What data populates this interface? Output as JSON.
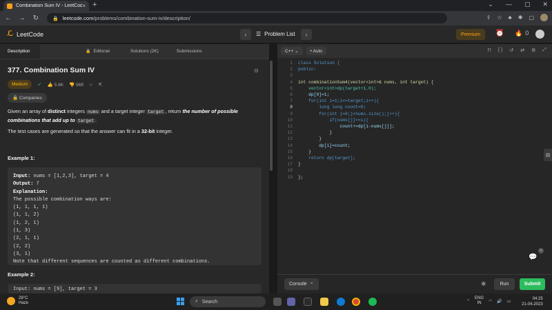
{
  "browser": {
    "tab_title": "Combination Sum IV - LeetCode",
    "tab_close": "×",
    "new_tab": "+",
    "window_controls": [
      "⌄",
      "—",
      "▢",
      "✕"
    ],
    "url_host": "leetcode.com",
    "url_path": "/problems/combination-sum-iv/description/",
    "extensions": [
      "⇪",
      "☆",
      "♣",
      "✱",
      "▢"
    ]
  },
  "header": {
    "logo": "LeetCode",
    "problem_list": "Problem List",
    "premium": "Premium",
    "streak": "0"
  },
  "left_tabs": [
    "Description",
    "Editorial",
    "Solutions (2K)",
    "Submissions"
  ],
  "problem": {
    "title": "377. Combination Sum IV",
    "difficulty": "Medium",
    "likes": "5.6K",
    "dislikes": "569",
    "companies": "Companies",
    "desc_1": "Given an array of ",
    "desc_bold": "distinct",
    "desc_2": " integers ",
    "desc_code1": "nums",
    "desc_3": " and a target integer ",
    "desc_code2": "target",
    "desc_4": ", return ",
    "desc_ital": "the number of possible combinations that add up to",
    "desc_5": " ",
    "desc_code3": "target",
    "desc_6": ".",
    "fit_1": "The test cases are generated so that the answer can fit in a ",
    "fit_bold": "32-bit",
    "fit_2": " integer.",
    "example1_header": "Example 1:",
    "example1": {
      "input_label": "Input:",
      "input": " nums = [1,2,3], target = 4",
      "output_label": "Output:",
      "output": " 7",
      "explanation_label": "Explanation:",
      "lines": [
        "The possible combination ways are:",
        "(1, 1, 1, 1)",
        "(1, 1, 2)",
        "(1, 2, 1)",
        "(1, 3)",
        "(2, 1, 1)",
        "(2, 2)",
        "(3, 1)",
        "Note that different sequences are counted as different combinations."
      ]
    },
    "example2_header": "Example 2:",
    "example2_input": "Input: nums = [9], target = 3"
  },
  "editor": {
    "language": "C++",
    "mode": "Auto",
    "line_numbers": [
      "1",
      "2",
      "3",
      "4",
      "5",
      "6",
      "7",
      "8",
      "9",
      "10",
      "11",
      "12",
      "13",
      "14",
      "15",
      "16",
      "17",
      "18",
      "19"
    ],
    "code": [
      "class Solution {",
      "public:",
      "",
      "int combinationSum4(vector<int>& nums, int target) {",
      "    vector<int>dp(target+1,0);",
      "    dp[0]=1;",
      "    for(int i=1;i<=target;i++){",
      "        long long count=0;",
      "        for(int j=0;j<nums.size();j++){",
      "            if(nums[j]<=i){",
      "                count+=dp[i-nums[j]];",
      "            }",
      "        }",
      "        dp[i]=count;",
      "    }",
      "    return dp[target];",
      "}",
      "",
      "};"
    ],
    "console": "Console",
    "run": "Run",
    "submit": "Submit"
  },
  "taskbar": {
    "temp": "28°C",
    "weather": "Haze",
    "search": "Search",
    "lang1": "ENG",
    "lang2": "IN",
    "time": "04:25",
    "date": "21-04-2023"
  }
}
